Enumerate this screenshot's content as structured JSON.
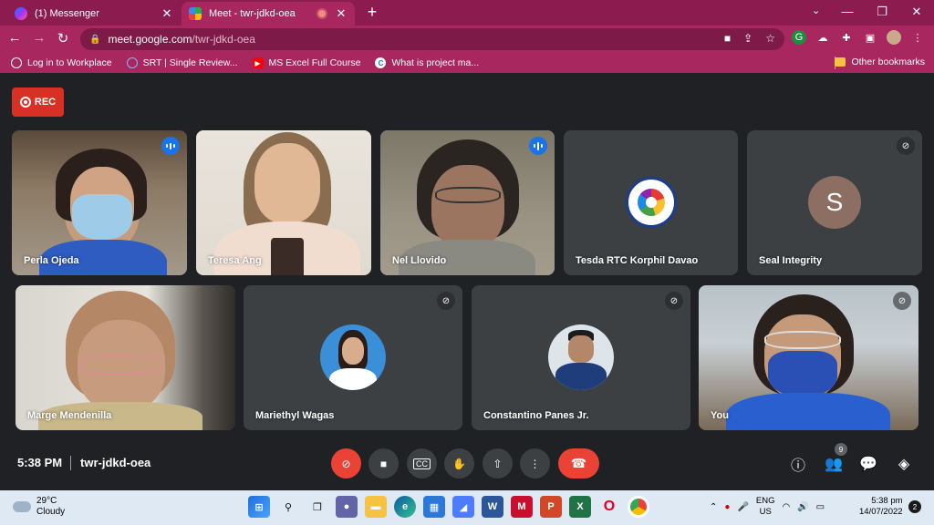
{
  "browser": {
    "tabs": [
      {
        "title": "(1) Messenger",
        "close": "✕"
      },
      {
        "title": "Meet - twr-jdkd-oea",
        "close": "✕"
      }
    ],
    "new_tab": "+",
    "url_host": "meet.google.com",
    "url_path": "/twr-jdkd-oea",
    "bookmarks": [
      {
        "label": "Log in to Workplace",
        "color": "#ffffff"
      },
      {
        "label": "SRT | Single Review...",
        "color": "#4285f4"
      },
      {
        "label": "MS Excel Full Course",
        "color": "#ff0000"
      },
      {
        "label": "What is project ma...",
        "color": "#1a73e8"
      }
    ],
    "other_bookmarks": "Other bookmarks"
  },
  "meet": {
    "rec_label": "REC",
    "participants": [
      {
        "name": "Perla Ojeda",
        "state": "speaking"
      },
      {
        "name": "Teresa Ang",
        "state": "none"
      },
      {
        "name": "Nel Llovido",
        "state": "speaking"
      },
      {
        "name": "Tesda RTC Korphil Davao",
        "state": "none"
      },
      {
        "name": "Seal Integrity",
        "state": "muted",
        "initial": "S"
      },
      {
        "name": "Marge Mendenilla",
        "state": "none"
      },
      {
        "name": "Mariethyl Wagas",
        "state": "muted"
      },
      {
        "name": "Constantino Panes Jr.",
        "state": "muted"
      },
      {
        "name": "You",
        "state": "muted"
      }
    ],
    "time": "5:38 PM",
    "meeting_code": "twr-jdkd-oea",
    "participant_count": "9"
  },
  "taskbar": {
    "temperature": "29°C",
    "condition": "Cloudy",
    "lang_top": "ENG",
    "lang_bottom": "US",
    "clock_time": "5:38 pm",
    "clock_date": "14/07/2022",
    "notifications": "2"
  }
}
